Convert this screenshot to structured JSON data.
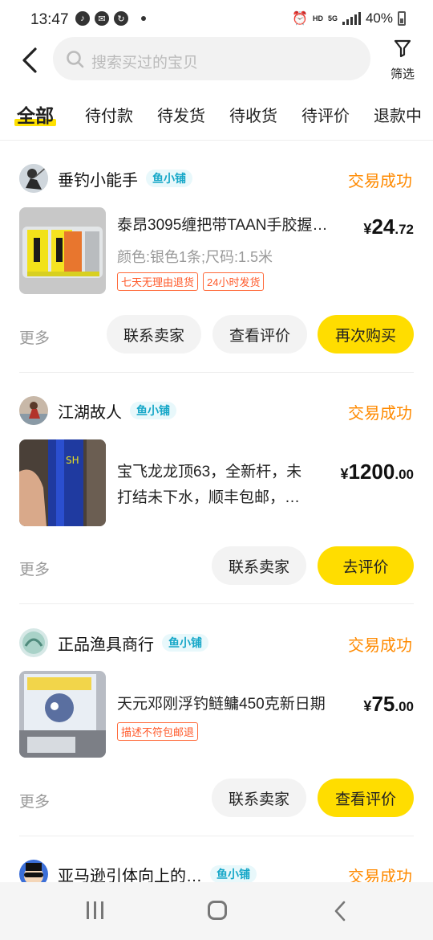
{
  "status_bar": {
    "time": "13:47",
    "network": "HD",
    "network_sub": "5G",
    "battery": "40%"
  },
  "header": {
    "search_placeholder": "搜索买过的宝贝",
    "filter_label": "筛选"
  },
  "tabs": [
    {
      "label": "全部",
      "active": true
    },
    {
      "label": "待付款",
      "active": false
    },
    {
      "label": "待发货",
      "active": false
    },
    {
      "label": "待收货",
      "active": false
    },
    {
      "label": "待评价",
      "active": false
    },
    {
      "label": "退款中",
      "active": false
    }
  ],
  "orders": [
    {
      "shop": "垂钓小能手",
      "badge": "鱼小铺",
      "status": "交易成功",
      "title_line1": "泰昂3095缠把带TAAN手胶握…",
      "spec": "颜色:银色1条;尺码:1.5米",
      "tags": [
        "七天无理由退货",
        "24小时发货"
      ],
      "price_symbol": "¥",
      "price_int": "24",
      "price_dec": ".72",
      "more": "更多",
      "buttons": [
        "联系卖家",
        "查看评价",
        "再次购买"
      ]
    },
    {
      "shop": "江湖故人",
      "badge": "鱼小铺",
      "status": "交易成功",
      "title_line1": "宝飞龙龙顶63，全新杆，未",
      "title_line2": "打结未下水，顺丰包邮，…",
      "price_symbol": "¥",
      "price_int": "1200",
      "price_dec": ".00",
      "more": "更多",
      "buttons": [
        "联系卖家",
        "去评价"
      ]
    },
    {
      "shop": "正品渔具商行",
      "badge": "鱼小铺",
      "status": "交易成功",
      "title_line1": "天元邓刚浮钓鲢鳙450克新日期",
      "tags": [
        "描述不符包邮退"
      ],
      "price_symbol": "¥",
      "price_int": "75",
      "price_dec": ".00",
      "more": "更多",
      "buttons": [
        "联系卖家",
        "查看评价"
      ]
    },
    {
      "shop": "亚马逊引体向上的…",
      "badge": "鱼小铺",
      "status": "交易成功"
    }
  ],
  "colors": {
    "accent_yellow": "#ffdd00",
    "status_orange": "#ff8a00",
    "badge_cyan": "#16a7c8",
    "tag_red": "#ff5a2a"
  }
}
